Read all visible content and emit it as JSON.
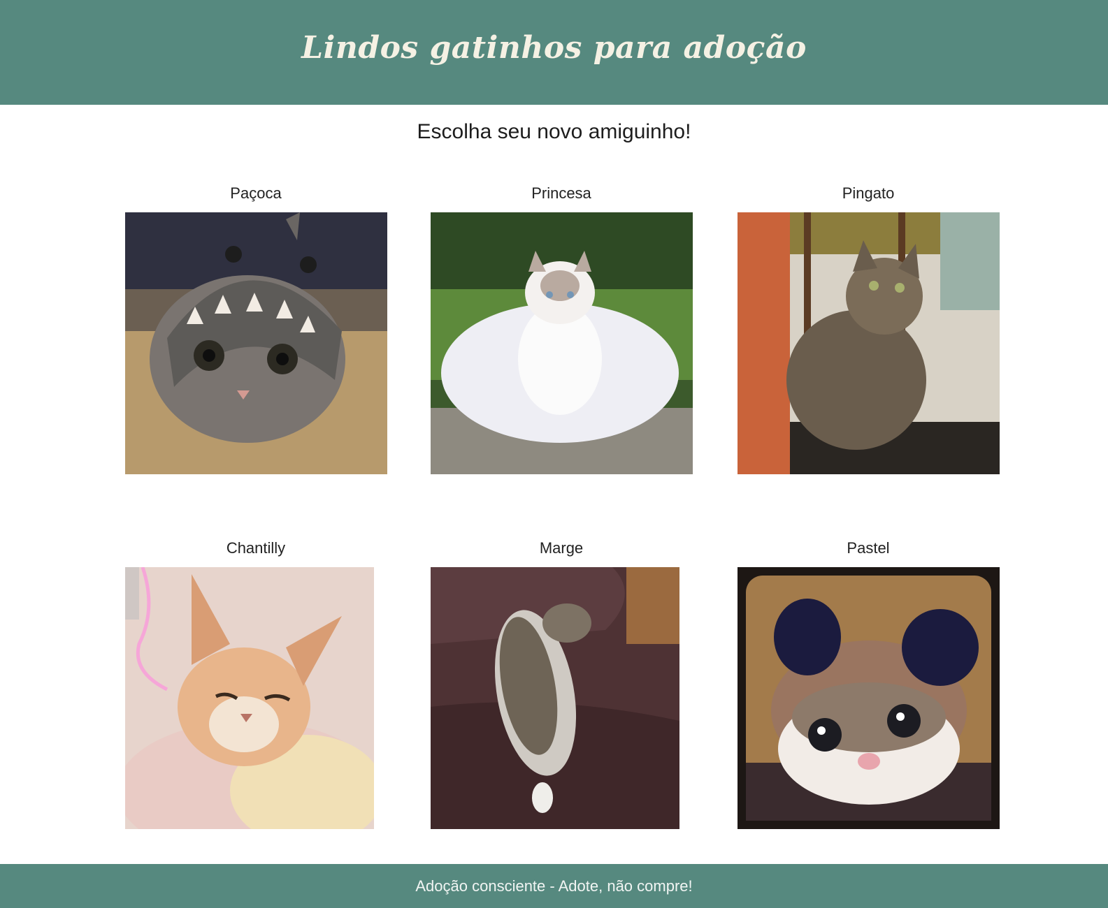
{
  "header": {
    "title": "Lindos gatinhos para adoção"
  },
  "main": {
    "subtitle": "Escolha seu novo amiguinho!",
    "cats": [
      {
        "name": "Paçoca"
      },
      {
        "name": "Princesa"
      },
      {
        "name": "Pingato"
      },
      {
        "name": "Chantilly"
      },
      {
        "name": "Marge"
      },
      {
        "name": "Pastel"
      }
    ]
  },
  "footer": {
    "text": "Adoção consciente - Adote, não compre!"
  },
  "colors": {
    "brand": "#56897f",
    "header_text": "#f5f1e4",
    "background": "#ffffff"
  }
}
